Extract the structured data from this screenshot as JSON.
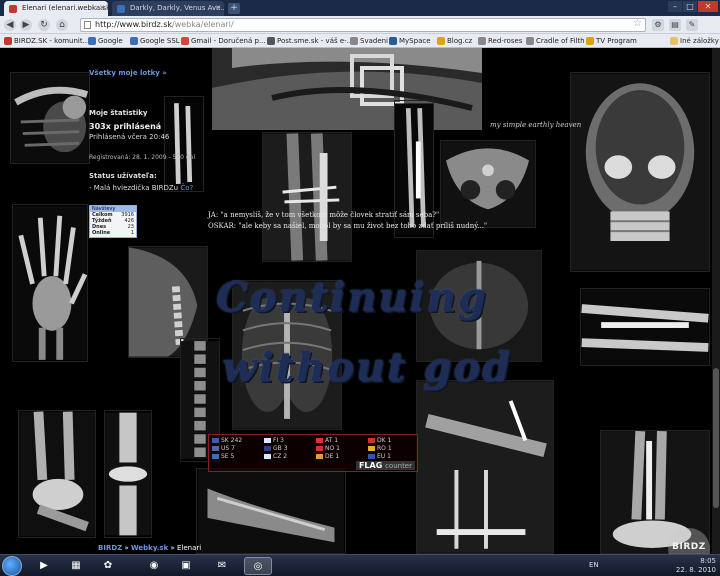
{
  "browser": {
    "tabs": [
      {
        "title": "Elenari (elenari.webka.sk)...",
        "active": true,
        "favicon_color": "#c0392b"
      },
      {
        "title": "Darkly, Darkly, Venus Ave...",
        "active": false,
        "favicon_color": "#3b6fb6"
      }
    ],
    "url_host": "http://www.birdz.sk",
    "url_path": "/webka/elenari/",
    "bookmarks": [
      {
        "label": "BIRDZ.SK - komunit...",
        "icon_color": "#c0392b"
      },
      {
        "label": "Google",
        "icon_color": "#3b6fb6"
      },
      {
        "label": "Google SSL",
        "icon_color": "#3b6fb6"
      },
      {
        "label": "Gmail - Doručená p...",
        "icon_color": "#d44638"
      },
      {
        "label": "Post.sme.sk - váš e-...",
        "icon_color": "#555555"
      },
      {
        "label": "Svadeni",
        "icon_color": "#888888"
      },
      {
        "label": "MySpace",
        "icon_color": "#2b5a9c"
      },
      {
        "label": "Blog.cz",
        "icon_color": "#e0a020"
      },
      {
        "label": "Red-roses",
        "icon_color": "#888888"
      },
      {
        "label": "Cradle of Filth",
        "icon_color": "#888888"
      },
      {
        "label": "TV Program",
        "icon_color": "#d9a600"
      }
    ],
    "other_bookmarks": "Iné záložky"
  },
  "sidebar": {
    "all_posts_link": "Všetky moje lotky »",
    "stats_title": "Moje štatistiky",
    "logged_count": "303x prihlásená",
    "last_login": "Prihlásená včera 20:46",
    "registered": "Registrovaná: 28. 1. 2009 - 570 dní",
    "status_title": "Status užívateľa:",
    "status_value": "- Malá hviezdička BIRDZu",
    "status_badge": "Čo?"
  },
  "visit_counter": {
    "header": "Návštevy",
    "rows": [
      {
        "label": "Celkom",
        "value": "3916"
      },
      {
        "label": "Týždeň",
        "value": "426"
      },
      {
        "label": "Dnes",
        "value": "23"
      },
      {
        "label": "Online",
        "value": "1"
      }
    ]
  },
  "content": {
    "caption": "my simple earthly heaven",
    "quote_1": "JA: \"a nemyslíš, že v tom všetkom môže človek stratiť sám seba?\"",
    "quote_2": "OSKAR: \"ale keby sa našiel, mohol by sa mu život bez toho zdať príliš nudný...\"",
    "gothic_line_1": "Continuing",
    "gothic_line_2": "without god"
  },
  "flag_counter": {
    "entries": [
      {
        "code": "SK",
        "count": "242",
        "color": "#3b5bb0"
      },
      {
        "code": "FI",
        "count": "3",
        "color": "#dfe8ff"
      },
      {
        "code": "AT",
        "count": "1",
        "color": "#d33"
      },
      {
        "code": "DK",
        "count": "1",
        "color": "#c33"
      },
      {
        "code": "US",
        "count": "7",
        "color": "#5566aa"
      },
      {
        "code": "GB",
        "count": "3",
        "color": "#2b3f85"
      },
      {
        "code": "NO",
        "count": "1",
        "color": "#c33"
      },
      {
        "code": "RO",
        "count": "1",
        "color": "#e0b030"
      },
      {
        "code": "SE",
        "count": "5",
        "color": "#3a6fc0"
      },
      {
        "code": "CZ",
        "count": "2",
        "color": "#dfe8ff"
      },
      {
        "code": "DE",
        "count": "1",
        "color": "#e0a020"
      },
      {
        "code": "EU",
        "count": "1",
        "color": "#3355aa"
      }
    ],
    "brand_flag": "FLAG",
    "brand_counter": "counter"
  },
  "footer": {
    "crumb_site": "BIRDZ",
    "crumb_sep1": " » ",
    "crumb_section": "Webky.sk",
    "crumb_sep2": " » ",
    "crumb_page": "Elenari"
  },
  "taskbar": {
    "language": "EN",
    "time": "8:05",
    "date": "22. 8. 2010",
    "watermark": "BIRDZ"
  }
}
